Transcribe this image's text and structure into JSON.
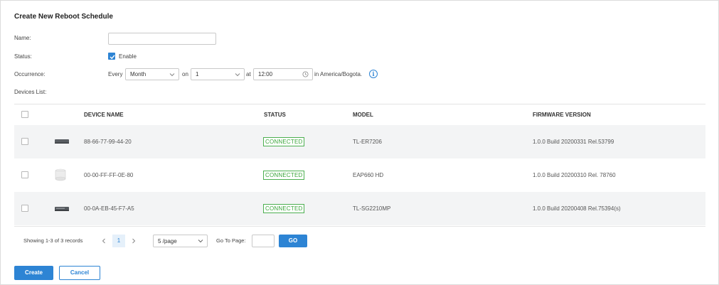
{
  "title": "Create New Reboot Schedule",
  "form": {
    "name_label": "Name:",
    "name_value": "",
    "status_label": "Status:",
    "status_option": "Enable",
    "status_checked": true,
    "occurrence_label": "Occurrence:",
    "every_text": "Every",
    "period_value": "Month",
    "on_text": "on",
    "day_value": "1",
    "at_text": "at",
    "time_value": "12:00",
    "timezone_text": "in America/Bogota.",
    "devices_label": "Devices List:"
  },
  "table": {
    "headers": [
      "DEVICE NAME",
      "STATUS",
      "MODEL",
      "FIRMWARE VERSION"
    ],
    "rows": [
      {
        "icon": "router-icon",
        "name": "88-66-77-99-44-20",
        "status": "CONNECTED",
        "model": "TL-ER7206",
        "firmware": "1.0.0 Build 20200331 Rel.53799"
      },
      {
        "icon": "access-point-icon",
        "name": "00-00-FF-FF-0E-80",
        "status": "CONNECTED",
        "model": "EAP660 HD",
        "firmware": "1.0.0 Build 20200310 Rel. 78760"
      },
      {
        "icon": "switch-icon",
        "name": "00-0A-EB-45-F7-A5",
        "status": "CONNECTED",
        "model": "TL-SG2210MP",
        "firmware": "1.0.0 Build 20200408 Rel.75394(s)"
      }
    ]
  },
  "pagination": {
    "summary": "Showing 1-3 of 3 records",
    "current_page": "1",
    "page_size": "5 /page",
    "goto_label": "Go To Page:",
    "goto_value": "",
    "go_label": "GO"
  },
  "actions": {
    "create_label": "Create",
    "cancel_label": "Cancel"
  },
  "colors": {
    "accent": "#2d84d4",
    "connected": "#4caf50",
    "row_alt": "#f3f4f5"
  }
}
